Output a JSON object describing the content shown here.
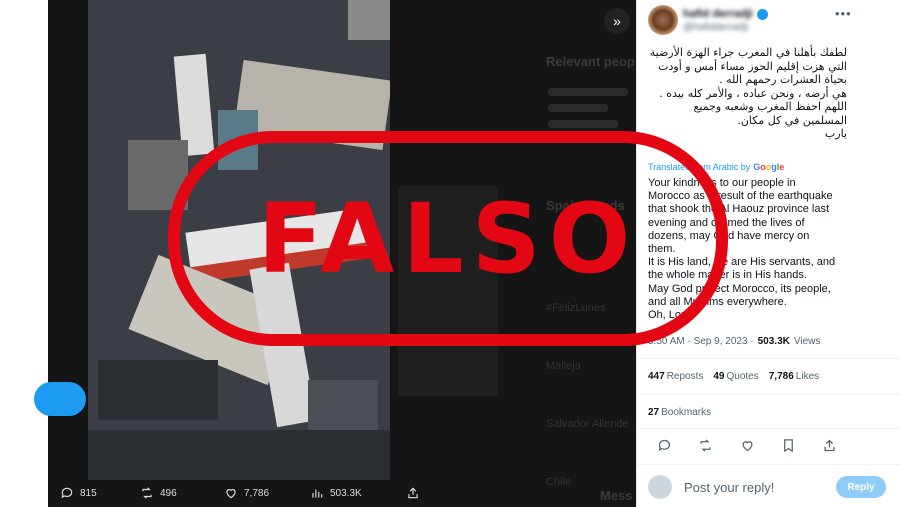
{
  "viewer": {
    "background_sidebar": {
      "relevant_title": "Relevant peop",
      "spain_trends_title": "Spain trends",
      "trend_1": "#FelizLunes",
      "trend_2": "Malleja",
      "trend_3": "Salvador Allende",
      "trend_4": "Chile",
      "messages": "Mess"
    },
    "stats": {
      "replies": "815",
      "reposts": "496",
      "likes": "7,786",
      "views": "503.3K"
    }
  },
  "stamp": {
    "text": "FALSO",
    "color": "#e30613"
  },
  "tweet": {
    "arabic_text": "لطفك بأهلنا في المغرب جراء الهزة الأرضية\nالتي هزت إقليم الحوز مساء أمس و أودت\nبحياة العشرات رحمهم الله .\nهي أرضه ، ونحن عباده ، والأمر كله بيده .\nاللهم احفظ المغرب وشعبه وجميع\nالمسلمين في كل مكان.\nيارب",
    "translated_label": "Translated from Arabic by",
    "google_letters": [
      "G",
      "o",
      "o",
      "g",
      "l",
      "e"
    ],
    "english_text": "Your kindness to our people in\nMorocco as a result of the earthquake\nthat shook the Al Haouz province last\nevening and claimed the lives of\ndozens, may God have mercy on\nthem.\nIt is His land, we are His servants, and\nthe whole matter is in His hands.\nMay God protect Morocco, its people,\nand all Muslims everywhere.\nOh, Lord",
    "timestamp": "5:50 AM · Sep 9, 2023 ·",
    "views_value": "503.3K",
    "views_label": "Views",
    "reposts_value": "447",
    "reposts_label": "Reposts",
    "quotes_value": "49",
    "quotes_label": "Quotes",
    "likes_value": "7,786",
    "likes_label": "Likes",
    "bookmarks_value": "27",
    "bookmarks_label": "Bookmarks",
    "reply_placeholder": "Post your reply!",
    "reply_button": "Reply"
  },
  "colors": {
    "accent": "#1d9bf0",
    "reply_disabled": "#8ecdf8"
  }
}
